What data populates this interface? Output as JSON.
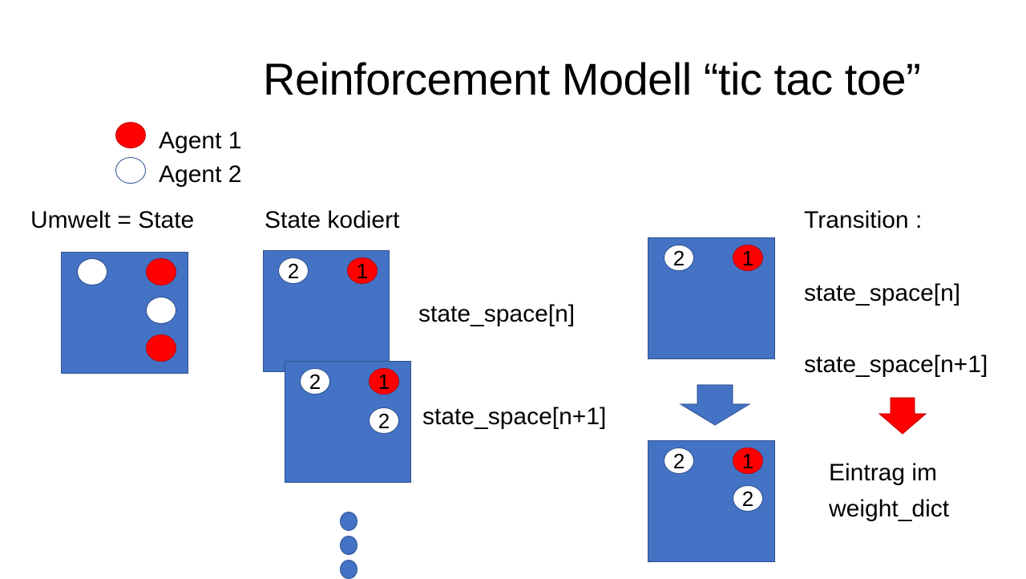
{
  "title": "Reinforcement Modell “tic tac toe”",
  "legend": {
    "agent1": "Agent 1",
    "agent2": "Agent 2"
  },
  "labels": {
    "umwelt": "Umwelt = State",
    "state_kodiert": "State kodiert",
    "state_n": "state_space[n]",
    "state_n1": "state_space[n+1]",
    "transition": "Transition :",
    "trans_state_n": "state_space[n]",
    "trans_state_n1": "state_space[n+1]",
    "eintrag_line1": "Eintrag im",
    "eintrag_line2": "weight_dict"
  },
  "marks": {
    "one": "1",
    "two": "2"
  },
  "colors": {
    "board": "#4472c4",
    "agent1": "#ff0000",
    "agent2": "#ffffff",
    "arrow_blue": "#4472c4",
    "arrow_red": "#ff0000"
  }
}
